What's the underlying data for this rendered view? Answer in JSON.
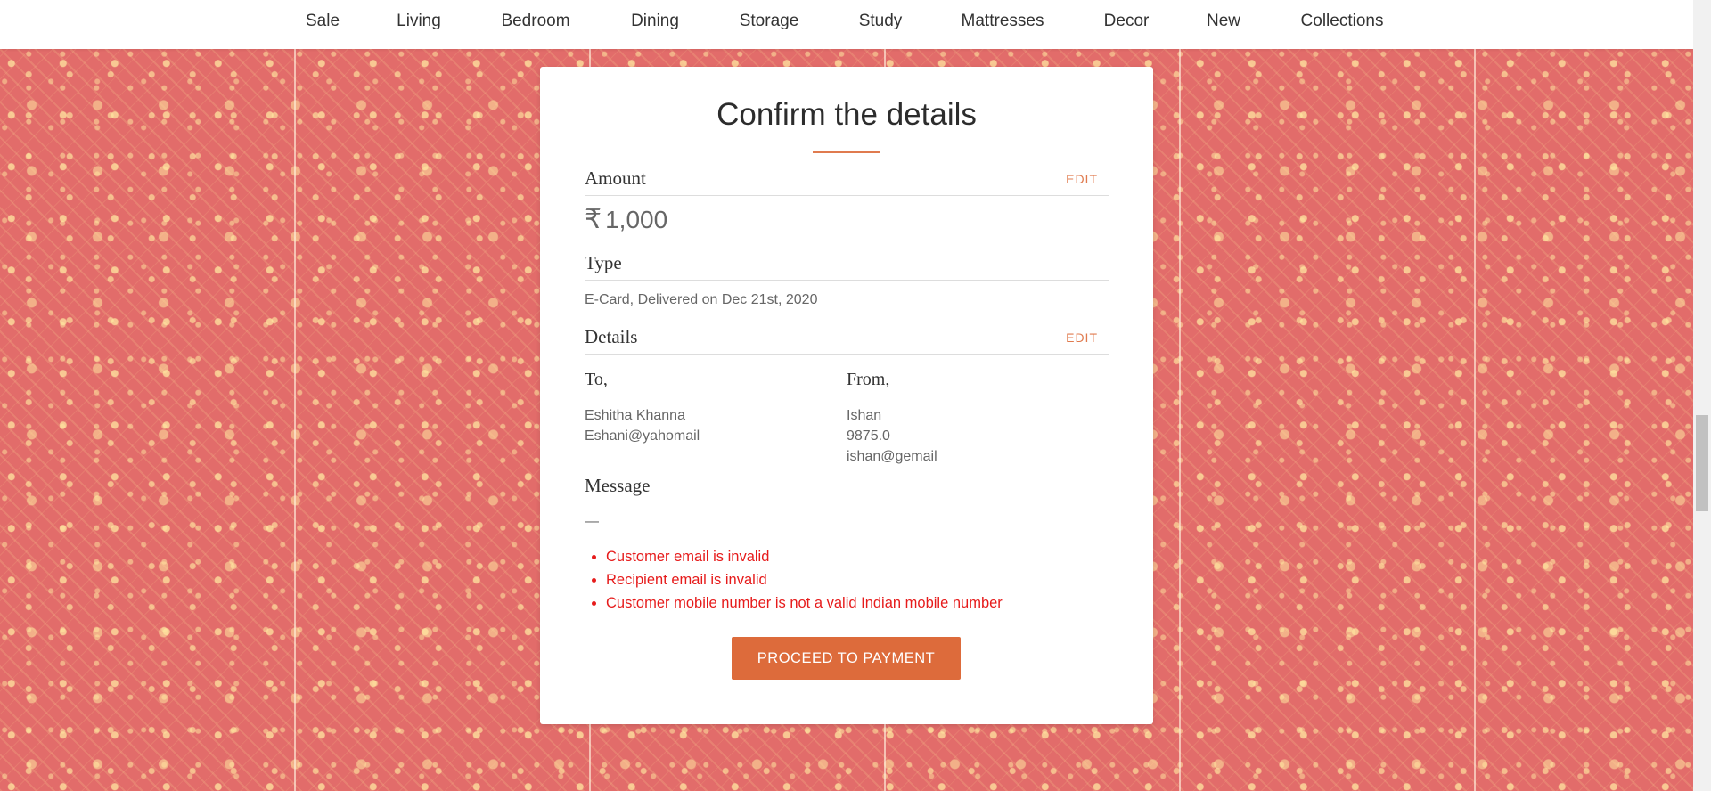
{
  "nav": {
    "items": [
      {
        "label": "Sale"
      },
      {
        "label": "Living"
      },
      {
        "label": "Bedroom"
      },
      {
        "label": "Dining"
      },
      {
        "label": "Storage"
      },
      {
        "label": "Study"
      },
      {
        "label": "Mattresses"
      },
      {
        "label": "Decor"
      },
      {
        "label": "New"
      },
      {
        "label": "Collections"
      }
    ]
  },
  "card": {
    "title": "Confirm the details",
    "amount": {
      "label": "Amount",
      "edit_label": "EDIT",
      "currency_symbol": "₹",
      "value": "1,000"
    },
    "type": {
      "label": "Type",
      "value": "E-Card, Delivered on Dec 21st, 2020"
    },
    "details": {
      "label": "Details",
      "edit_label": "EDIT",
      "to": {
        "label": "To,",
        "name": "Eshitha Khanna",
        "email": "Eshani@yahomail"
      },
      "from": {
        "label": "From,",
        "name": "Ishan",
        "phone": "9875.0",
        "email": "ishan@gemail"
      }
    },
    "message": {
      "label": "Message",
      "value": "—"
    },
    "errors": [
      "Customer email is invalid",
      "Recipient email is invalid",
      "Customer mobile number is not a valid Indian mobile number"
    ],
    "proceed_label": "PROCEED TO PAYMENT"
  },
  "colors": {
    "background_pattern": "#e26c6a",
    "accent": "#dd6b3b",
    "error": "#e61b1b"
  }
}
